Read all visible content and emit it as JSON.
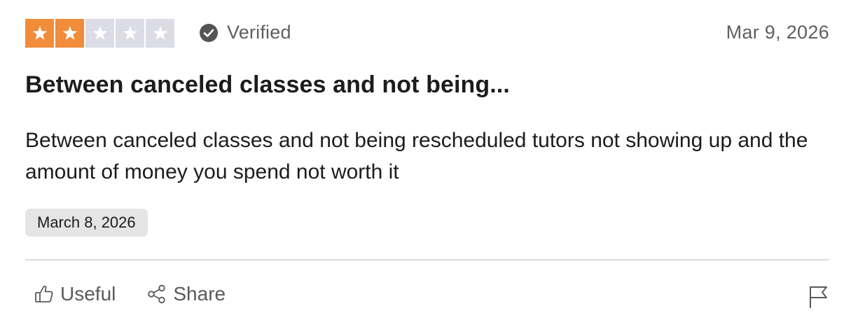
{
  "rating": {
    "value": 2,
    "max": 5,
    "filled_color": "#f08c3a",
    "empty_color": "#dcdce6",
    "star_icon": "star-icon"
  },
  "verified": {
    "label": "Verified",
    "icon": "check-circle-icon"
  },
  "review_date": "Mar 9, 2026",
  "title": "Between canceled classes and not being...",
  "body": "Between canceled classes and not being rescheduled tutors not showing up and the amount of money you spend not worth it",
  "experience_date": "March 8, 2026",
  "actions": {
    "useful_label": "Useful",
    "useful_icon": "thumbs-up-icon",
    "share_label": "Share",
    "share_icon": "share-icon",
    "report_icon": "flag-icon"
  }
}
